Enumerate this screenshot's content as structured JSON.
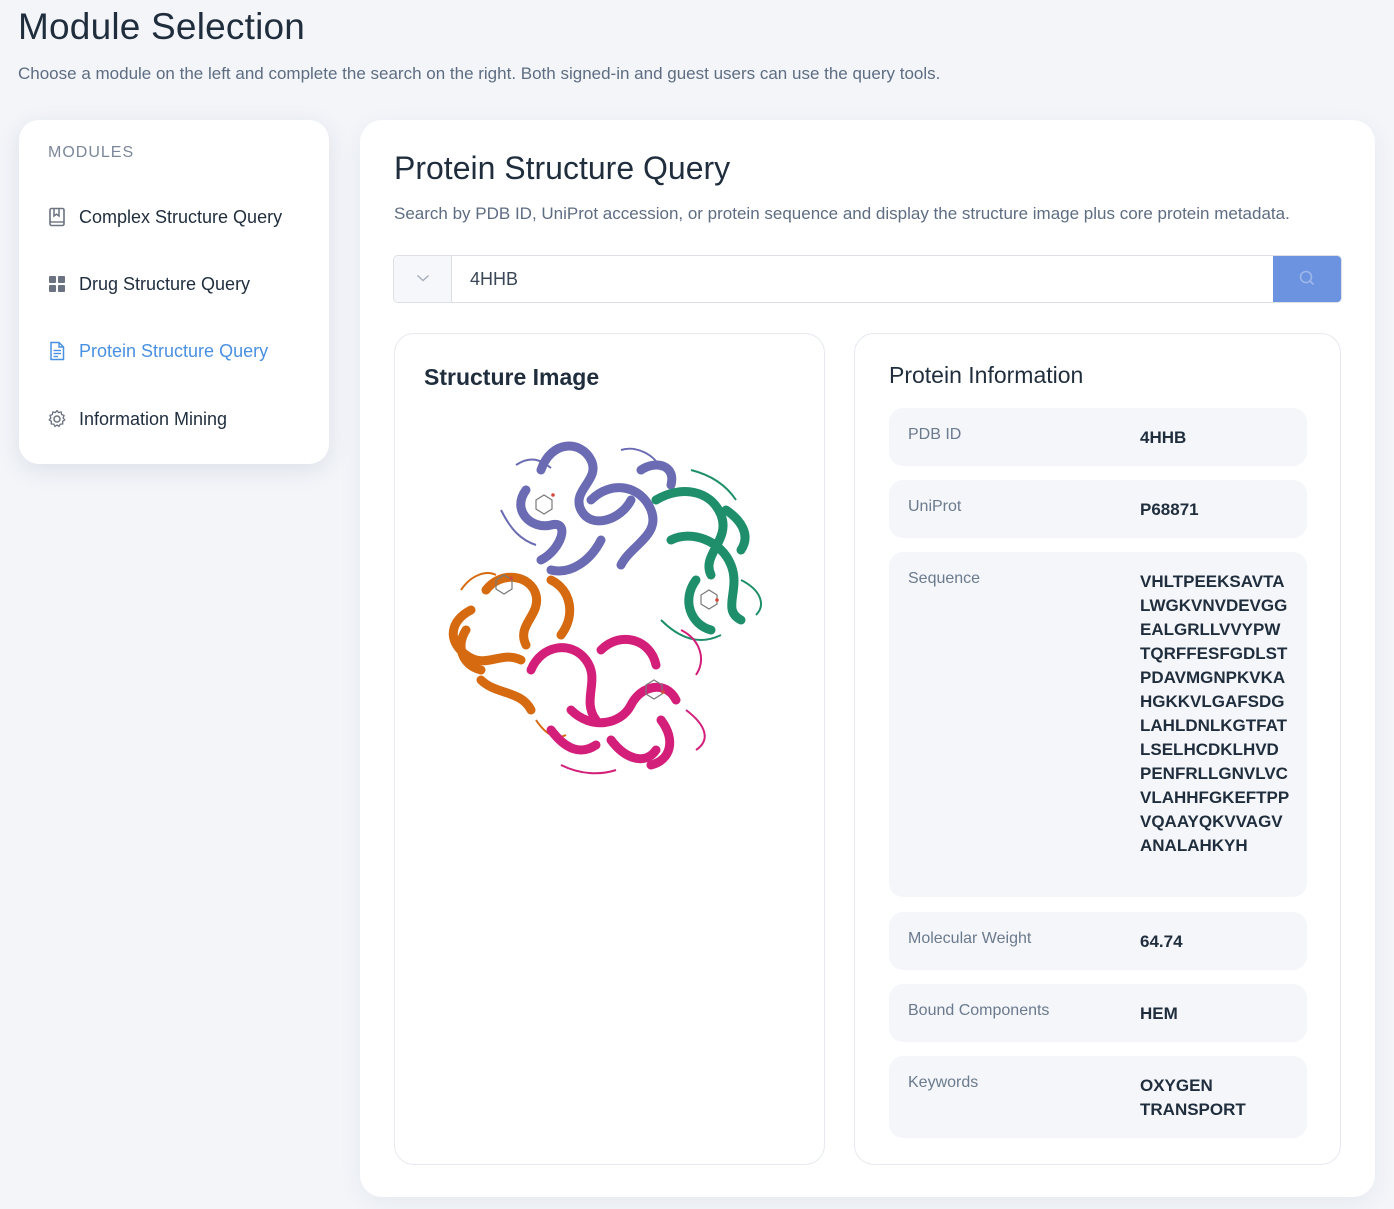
{
  "page": {
    "title": "Module Selection",
    "subtitle": "Choose a module on the left and complete the search on the right. Both signed-in and guest users can use the query tools."
  },
  "sidebar": {
    "heading": "MODULES",
    "items": [
      {
        "label": "Complex Structure Query",
        "icon": "bookmark-book-icon"
      },
      {
        "label": "Drug Structure Query",
        "icon": "grid-icon"
      },
      {
        "label": "Protein Structure Query",
        "icon": "document-icon",
        "active": true
      },
      {
        "label": "Information Mining",
        "icon": "gear-icon"
      }
    ]
  },
  "main": {
    "title": "Protein Structure Query",
    "description": "Search by PDB ID, UniProt accession, or protein sequence and display the structure image plus core protein metadata.",
    "search": {
      "value": "4HHB",
      "placeholder": ""
    },
    "structure": {
      "title": "Structure Image"
    },
    "info": {
      "title": "Protein Information",
      "rows": [
        {
          "label": "PDB ID",
          "value": "4HHB"
        },
        {
          "label": "UniProt",
          "value": "P68871"
        },
        {
          "label": "Sequence",
          "value": "VHLTPEEKSAVTALWGKVNVDEVGGEALGRLLVVYPWTQRFFESFGDLSTPDAVMGNPKVKAHGKKVLGAFSDGLAHLDNLKGTFATLSELHCDKLHVDPENFRLLGNVLVCVLAHHFGKEFTPPVQAAYQKVVAGVANALAHKYH"
        },
        {
          "label": "Molecular Weight",
          "value": "64.74"
        },
        {
          "label": "Bound Components",
          "value": "HEM"
        },
        {
          "label": "Keywords",
          "value": "OXYGEN TRANSPORT"
        }
      ]
    }
  },
  "colors": {
    "accent": "#4a90e2",
    "search_button": "#6b93e0",
    "chain_purple": "#6a6bb3",
    "chain_green": "#1f8f6b",
    "chain_orange": "#d66a10",
    "chain_magenta": "#d41f7a"
  }
}
